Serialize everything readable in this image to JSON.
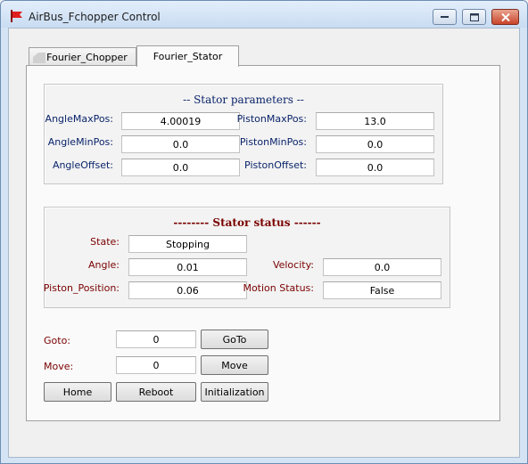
{
  "window": {
    "title": "AirBus_Fchopper Control",
    "icon": "red-flag-icon",
    "controls": [
      "minimize-icon",
      "maximize-icon",
      "close-icon"
    ]
  },
  "tabs": [
    {
      "label": "Fourier_Chopper",
      "active": false
    },
    {
      "label": "Fourier_Stator",
      "active": true
    }
  ],
  "stator_parameters": {
    "title": "-- Stator parameters --",
    "angle_max_pos": {
      "label": "AngleMaxPos:",
      "value": "4.00019"
    },
    "piston_max_pos": {
      "label": "PistonMaxPos:",
      "value": "13.0"
    },
    "angle_min_pos": {
      "label": "AngleMinPos:",
      "value": "0.0"
    },
    "piston_min_pos": {
      "label": "PistonMinPos:",
      "value": "0.0"
    },
    "angle_offset": {
      "label": "AngleOffset:",
      "value": "0.0"
    },
    "piston_offset": {
      "label": "PistonOffset:",
      "value": "0.0"
    }
  },
  "stator_status": {
    "title": "-------- Stator status ------",
    "state": {
      "label": "State:",
      "value": "Stopping"
    },
    "angle": {
      "label": "Angle:",
      "value": "0.01"
    },
    "velocity": {
      "label": "Velocity:",
      "value": "0.0"
    },
    "piston_position": {
      "label": "Piston_Position:",
      "value": "0.06"
    },
    "motion_status": {
      "label": "Motion Status:",
      "value": "False"
    }
  },
  "controls": {
    "goto_label": "Goto:",
    "goto_value": "0",
    "goto_button": "GoTo",
    "move_label": "Move:",
    "move_value": "0",
    "move_button": "Move",
    "home_button": "Home",
    "reboot_button": "Reboot",
    "init_button": "Initialization"
  },
  "colors": {
    "param_label": "#0a246a",
    "param_title": "#0a246a",
    "status_label": "#7a0000",
    "status_title": "#7a0000"
  }
}
